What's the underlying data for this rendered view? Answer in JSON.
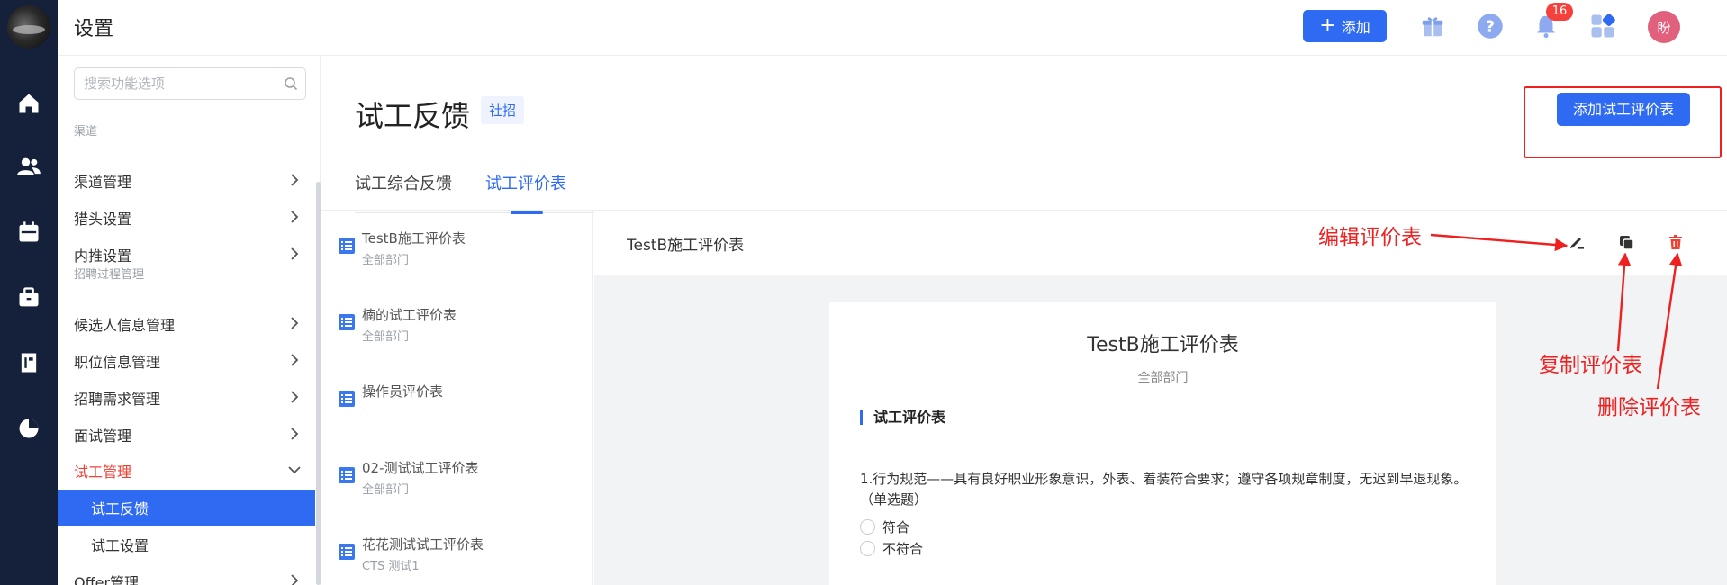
{
  "header": {
    "title": "设置",
    "add_button_label": "添加",
    "notification_count": "16",
    "avatar_text": "盼"
  },
  "rail": {
    "icons": [
      "home-icon",
      "users-icon",
      "calendar-icon",
      "briefcase-icon",
      "book-icon",
      "pie-chart-icon"
    ]
  },
  "sidebar": {
    "search_placeholder": "搜索功能选项",
    "section_channel": "渠道",
    "channel_items": [
      {
        "label": "渠道管理"
      },
      {
        "label": "猎头设置"
      },
      {
        "label": "内推设置"
      }
    ],
    "section_recruit": "招聘过程管理",
    "recruit_items": [
      {
        "label": "候选人信息管理"
      },
      {
        "label": "职位信息管理"
      },
      {
        "label": "招聘需求管理"
      },
      {
        "label": "面试管理"
      }
    ],
    "trial": {
      "label": "试工管理"
    },
    "trial_sub": [
      {
        "label": "试工反馈",
        "active": true
      },
      {
        "label": "试工设置",
        "active": false
      }
    ],
    "offer": {
      "label": "Offer管理"
    }
  },
  "main": {
    "page_title": "试工反馈",
    "page_tag": "社招",
    "add_form_button": "添加试工评价表",
    "tabs": [
      {
        "label": "试工综合反馈",
        "active": false
      },
      {
        "label": "试工评价表",
        "active": true
      }
    ],
    "forms": [
      {
        "name": "TestB施工评价表",
        "dept": "全部部门"
      },
      {
        "name": "楠的试工评价表",
        "dept": "全部部门"
      },
      {
        "name": "操作员评价表",
        "dept": "-"
      },
      {
        "name": "02-测试试工评价表",
        "dept": "全部部门"
      },
      {
        "name": "花花测试试工评价表",
        "dept": "CTS 测试1"
      }
    ],
    "detail": {
      "header_title": "TestB施工评价表",
      "card_title": "TestB施工评价表",
      "card_dept": "全部部门",
      "section_title": "试工评价表",
      "question": "1.行为规范——具有良好职业形象意识，外表、着装符合要求；遵守各项规章制度，无迟到早退现象。（单选题）",
      "options": [
        "符合",
        "不符合"
      ]
    }
  },
  "annotations": {
    "edit": "编辑评价表",
    "copy": "复制评价表",
    "delete": "删除评价表",
    "color": "#ee2020"
  },
  "colors": {
    "accent": "#2f6bf2",
    "rail_bg": "#15203a",
    "active_red": "#ef4036",
    "badge": "#f5403c"
  }
}
